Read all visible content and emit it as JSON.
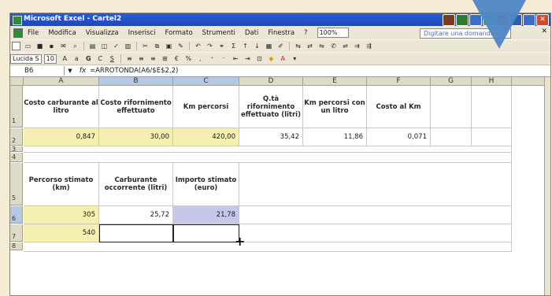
{
  "window": {
    "title": "Microsoft Excel - Cartel2"
  },
  "menu": {
    "items": [
      "File",
      "Modifica",
      "Visualizza",
      "Inserisci",
      "Formato",
      "Strumenti",
      "Dati",
      "Finestra",
      "?"
    ],
    "zoom": "100%",
    "ask_placeholder": "Digitare una domanda."
  },
  "toolbar": {
    "font_name": "Lucida S",
    "font_size": "10"
  },
  "formula_bar": {
    "name_box": "B6",
    "fx": "fx",
    "formula": "=ARROTONDA(A6/$E$2,2)"
  },
  "columns": [
    "A",
    "B",
    "C",
    "D",
    "E",
    "F",
    "G",
    "H"
  ],
  "rows": [
    "1",
    "2",
    "3",
    "4",
    "5",
    "6",
    "7",
    "8"
  ],
  "table1": {
    "headers": [
      "Costo carburante al litro",
      "Costo rifornimento effettuato",
      "Km percorsi",
      "Q.tà rifornimento effettuato (litri)",
      "Km percorsi con un litro",
      "Costo al Km"
    ],
    "values": [
      "0,847",
      "30,00",
      "420,00",
      "35,42",
      "11,86",
      "0,071"
    ]
  },
  "table2": {
    "headers": [
      "Percorso stimato (km)",
      "Carburante occorrente (litri)",
      "Importo stimato (euro)"
    ],
    "row6": [
      "305",
      "25,72",
      "21,78"
    ],
    "row7": [
      "540",
      "",
      ""
    ]
  },
  "colors": {
    "yellow": "#f5efb0",
    "blue": "#b9c6e8",
    "title_bar": "#1f48b8",
    "overlay_arrow": "#4f86c6"
  }
}
